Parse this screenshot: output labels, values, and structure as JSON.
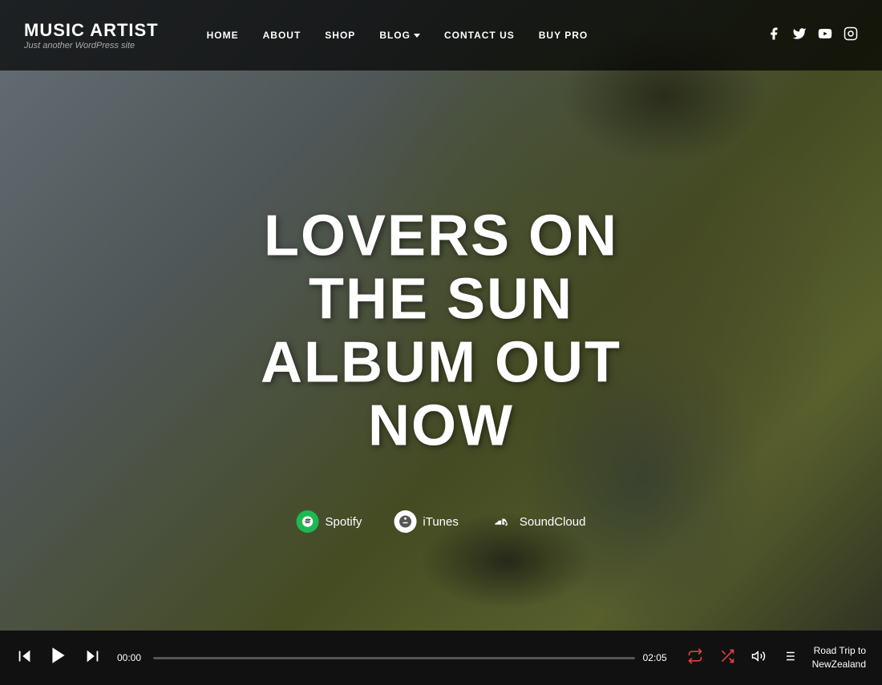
{
  "logo": {
    "title": "MUSIC ARTIST",
    "subtitle": "Just another WordPress site"
  },
  "nav": {
    "items": [
      {
        "label": "HOME",
        "has_dropdown": false
      },
      {
        "label": "ABOUT",
        "has_dropdown": false
      },
      {
        "label": "SHOP",
        "has_dropdown": false
      },
      {
        "label": "BLOG",
        "has_dropdown": true
      },
      {
        "label": "CONTACT US",
        "has_dropdown": false
      },
      {
        "label": "BUY PRO",
        "has_dropdown": false
      }
    ]
  },
  "social": {
    "facebook": "f",
    "twitter": "t",
    "youtube": "▶",
    "instagram": "📷"
  },
  "hero": {
    "line1": "LOVERS ON THE SUN",
    "line2": "ALBUM OUT NOW"
  },
  "streaming": [
    {
      "name": "Spotify",
      "icon_type": "spotify"
    },
    {
      "name": "iTunes",
      "icon_type": "itunes"
    },
    {
      "name": "SoundCloud",
      "icon_type": "soundcloud"
    }
  ],
  "player": {
    "time_current": "00:00",
    "time_total": "02:05",
    "now_playing_line1": "Road Trip to",
    "now_playing_line2": "NewZealand",
    "progress_percent": 0
  }
}
